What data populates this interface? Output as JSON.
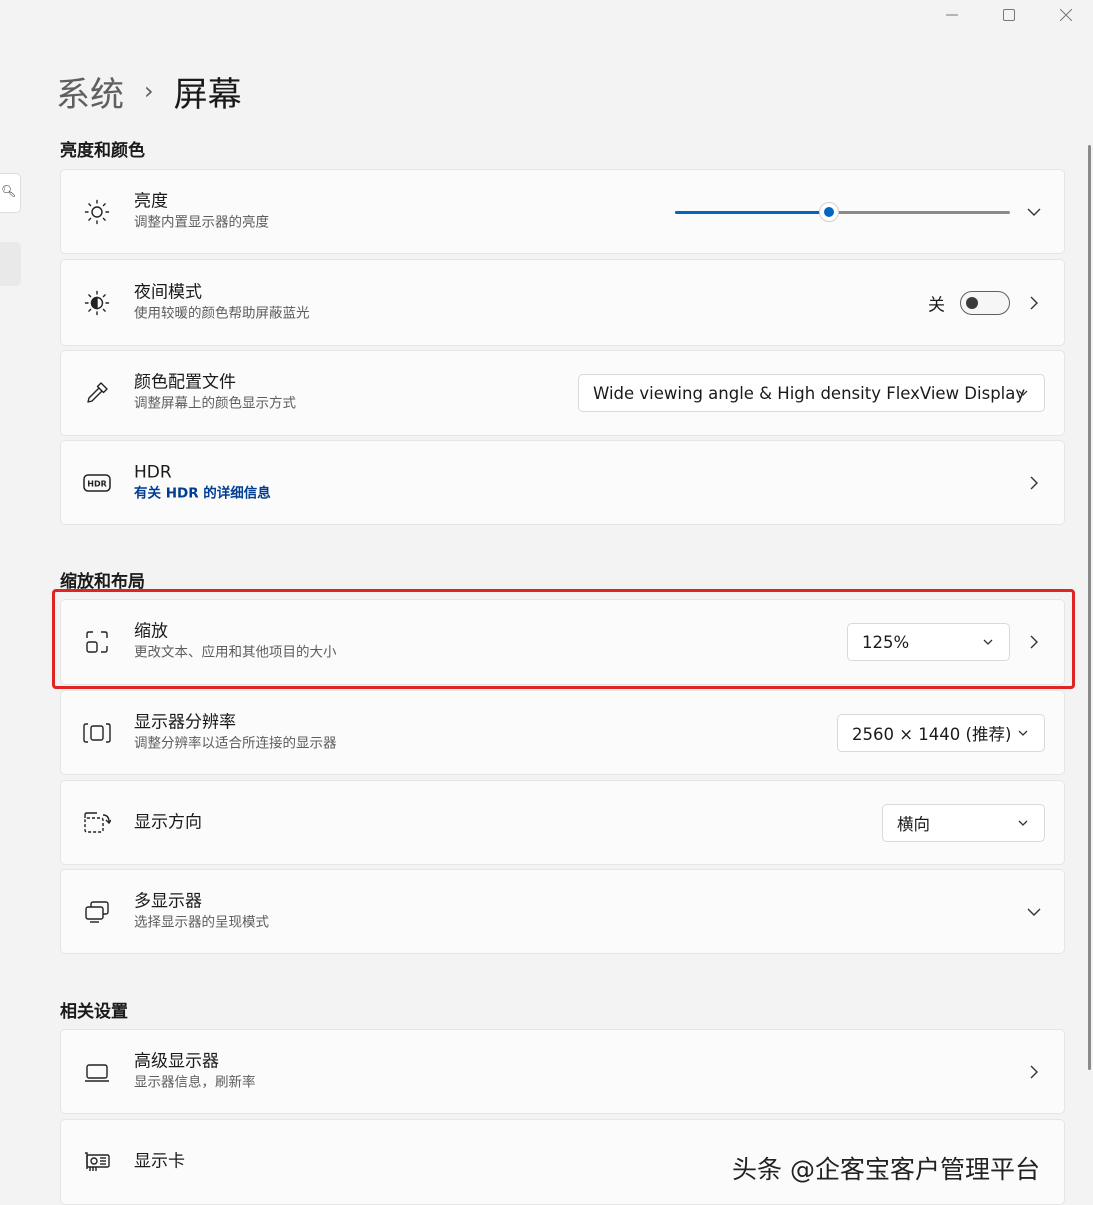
{
  "window": {
    "minimize_icon": "minimize-icon",
    "maximize_icon": "maximize-icon",
    "close_icon": "close-icon"
  },
  "breadcrumb": {
    "parent": "系统",
    "current": "屏幕"
  },
  "sections": {
    "brightness_color": "亮度和颜色",
    "scale_layout": "缩放和布局",
    "related": "相关设置"
  },
  "brightness": {
    "title": "亮度",
    "subtitle": "调整内置显示器的亮度",
    "value_percent": 46
  },
  "night_light": {
    "title": "夜间模式",
    "subtitle": "使用较暖的颜色帮助屏蔽蓝光",
    "state_label": "关",
    "on": false
  },
  "color_profile": {
    "title": "颜色配置文件",
    "subtitle": "调整屏幕上的颜色显示方式",
    "selected": "Wide viewing angle & High density FlexView Display"
  },
  "hdr": {
    "title": "HDR",
    "link": "有关 HDR 的详细信息"
  },
  "scale": {
    "title": "缩放",
    "subtitle": "更改文本、应用和其他项目的大小",
    "selected": "125%"
  },
  "resolution": {
    "title": "显示器分辨率",
    "subtitle": "调整分辨率以适合所连接的显示器",
    "selected": "2560 × 1440 (推荐)"
  },
  "orientation": {
    "title": "显示方向",
    "selected": "横向"
  },
  "multi_display": {
    "title": "多显示器",
    "subtitle": "选择显示器的呈现模式"
  },
  "advanced_display": {
    "title": "高级显示器",
    "subtitle": "显示器信息，刷新率"
  },
  "graphics": {
    "title": "显示卡"
  },
  "watermark": "头条 @企客宝客户管理平台",
  "colors": {
    "accent": "#0067c0",
    "highlight_box": "#e02424",
    "link": "#003e92"
  }
}
